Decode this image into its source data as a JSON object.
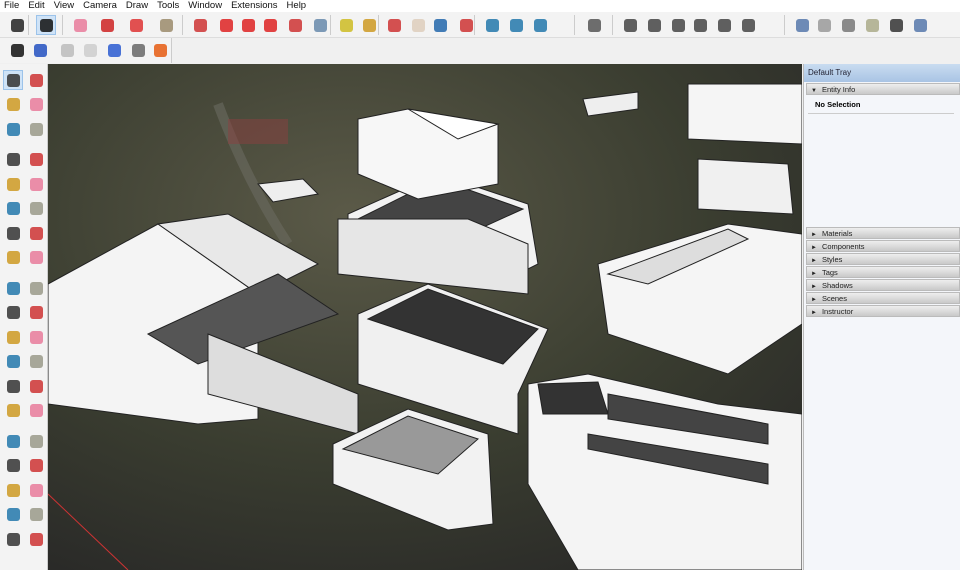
{
  "menu": [
    "File",
    "Edit",
    "View",
    "Camera",
    "Draw",
    "Tools",
    "Window",
    "Extensions",
    "Help"
  ],
  "toolbar_main": [
    {
      "icon": "zoom-extents-icon",
      "c": "#222"
    },
    {
      "icon": "select-icon",
      "c": "#111",
      "active": true
    },
    {
      "icon": "eraser-icon",
      "c": "#e87a9a"
    },
    {
      "icon": "pencil-line-icon",
      "c": "#c22"
    },
    {
      "icon": "arc-icon",
      "c": "#d33"
    },
    {
      "icon": "rectangle-icon",
      "c": "#9a8a6a"
    },
    {
      "icon": "push-pull-icon",
      "c": "#c33"
    },
    {
      "icon": "follow-me-icon",
      "c": "#d22"
    },
    {
      "icon": "move-icon",
      "c": "#d22"
    },
    {
      "icon": "rotate-icon",
      "c": "#d22"
    },
    {
      "icon": "scale-icon",
      "c": "#c33"
    },
    {
      "icon": "offset-icon",
      "c": "#68a"
    },
    {
      "icon": "tape-measure-icon",
      "c": "#cb2"
    },
    {
      "icon": "paint-bucket-icon",
      "c": "#c92"
    },
    {
      "icon": "orbit-icon",
      "c": "#c33"
    },
    {
      "icon": "pan-icon",
      "c": "#dcb"
    },
    {
      "icon": "zoom-icon",
      "c": "#26a"
    },
    {
      "icon": "zoom-window-icon",
      "c": "#c33"
    },
    {
      "icon": "warehouse-icon",
      "c": "#27a"
    },
    {
      "icon": "extension-warehouse-icon",
      "c": "#27a"
    },
    {
      "icon": "layout-icon",
      "c": "#27a"
    },
    {
      "icon": "user-icon",
      "c": "#555"
    },
    {
      "icon": "iso-view-icon",
      "c": "#444"
    },
    {
      "icon": "top-view-icon",
      "c": "#444"
    },
    {
      "icon": "front-view-icon",
      "c": "#444"
    },
    {
      "icon": "right-view-icon",
      "c": "#444"
    },
    {
      "icon": "back-view-icon",
      "c": "#444"
    },
    {
      "icon": "left-view-icon",
      "c": "#444"
    },
    {
      "icon": "xray-style-icon",
      "c": "#57a"
    },
    {
      "icon": "wireframe-style-icon",
      "c": "#999"
    },
    {
      "icon": "hidden-line-style-icon",
      "c": "#777"
    },
    {
      "icon": "shaded-style-icon",
      "c": "#aa8"
    },
    {
      "icon": "shaded-textures-style-icon",
      "c": "#333"
    },
    {
      "icon": "monochrome-style-icon",
      "c": "#57a"
    }
  ],
  "toolbar_secondary": [
    {
      "icon": "trimble-connect-icon",
      "c": "#111"
    },
    {
      "icon": "solid-tools-icon",
      "c": "#2250c0"
    },
    {
      "icon": "database-icon",
      "c": "#bbb"
    },
    {
      "icon": "arch-icon",
      "c": "#ccc"
    },
    {
      "icon": "help-icon",
      "c": "#2a5bd0"
    },
    {
      "icon": "settings-gear-icon",
      "c": "#666"
    },
    {
      "icon": "ruby-extension-icon",
      "c": "#e55a10"
    }
  ],
  "left_tools": [
    "select-icon",
    "orbit-icon",
    "paint-bucket-icon",
    "eraser-icon",
    "component-icon",
    "tag-icon",
    "pencil-line-icon",
    "freehand-icon",
    "rectangle-icon",
    "rotated-rectangle-icon",
    "circle-icon",
    "polygon-icon",
    "arc-icon",
    "two-point-arc-icon",
    "three-point-arc-icon",
    "pie-icon",
    "move-icon",
    "push-pull-icon",
    "rotate-icon",
    "follow-me-icon",
    "scale-icon",
    "offset-icon",
    "tape-measure-icon",
    "dimension-icon",
    "protractor-icon",
    "text-icon",
    "axes-icon",
    "3d-text-icon",
    "orbit-view-icon",
    "pan-icon",
    "zoom-icon",
    "zoom-window-icon",
    "zoom-extents-icon",
    "position-camera-icon",
    "walk-icon",
    "footprints-icon",
    "look-around-icon",
    "section-plane-icon"
  ],
  "tray": {
    "title": "Default Tray",
    "entity_info": {
      "label": "Entity Info",
      "value": "No Selection"
    },
    "panels": [
      "Materials",
      "Components",
      "Styles",
      "Tags",
      "Shadows",
      "Scenes",
      "Instructor"
    ]
  },
  "colors": {
    "accent": "#cfe3f7",
    "tray_header": "#b9d0ea"
  }
}
